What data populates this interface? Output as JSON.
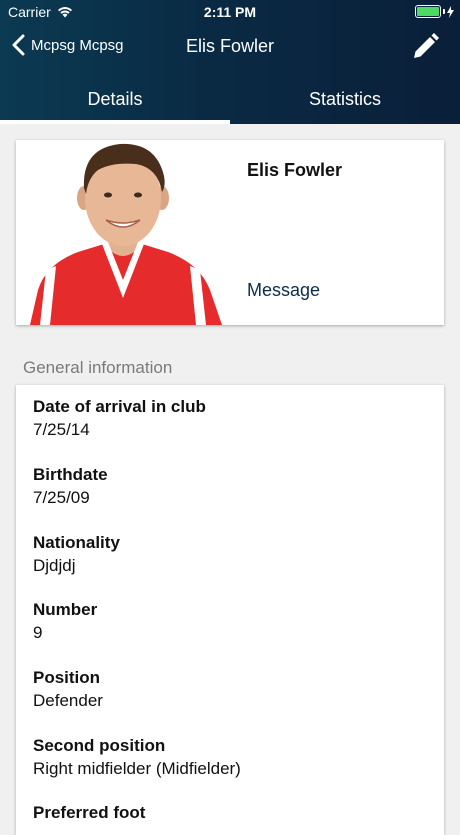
{
  "status": {
    "carrier": "Carrier",
    "time": "2:11 PM"
  },
  "nav": {
    "back_label": "Mcpsg Mcpsg",
    "title": "Elis Fowler"
  },
  "tabs": [
    {
      "label": "Details",
      "active": true
    },
    {
      "label": "Statistics",
      "active": false
    }
  ],
  "profile": {
    "name": "Elis Fowler",
    "message_label": "Message"
  },
  "general": {
    "section_title": "General information",
    "fields": [
      {
        "label": "Date of arrival in club",
        "value": "7/25/14"
      },
      {
        "label": "Birthdate",
        "value": "7/25/09"
      },
      {
        "label": "Nationality",
        "value": "Djdjdj"
      },
      {
        "label": "Number",
        "value": "9"
      },
      {
        "label": "Position",
        "value": "Defender"
      },
      {
        "label": "Second position",
        "value": "Right midfielder (Midfielder)"
      },
      {
        "label": "Preferred foot",
        "value": ""
      }
    ]
  },
  "colors": {
    "header": "#0a2a44",
    "link": "#0b2d4a",
    "jersey": "#e52b2b",
    "battery": "#4cd964"
  }
}
